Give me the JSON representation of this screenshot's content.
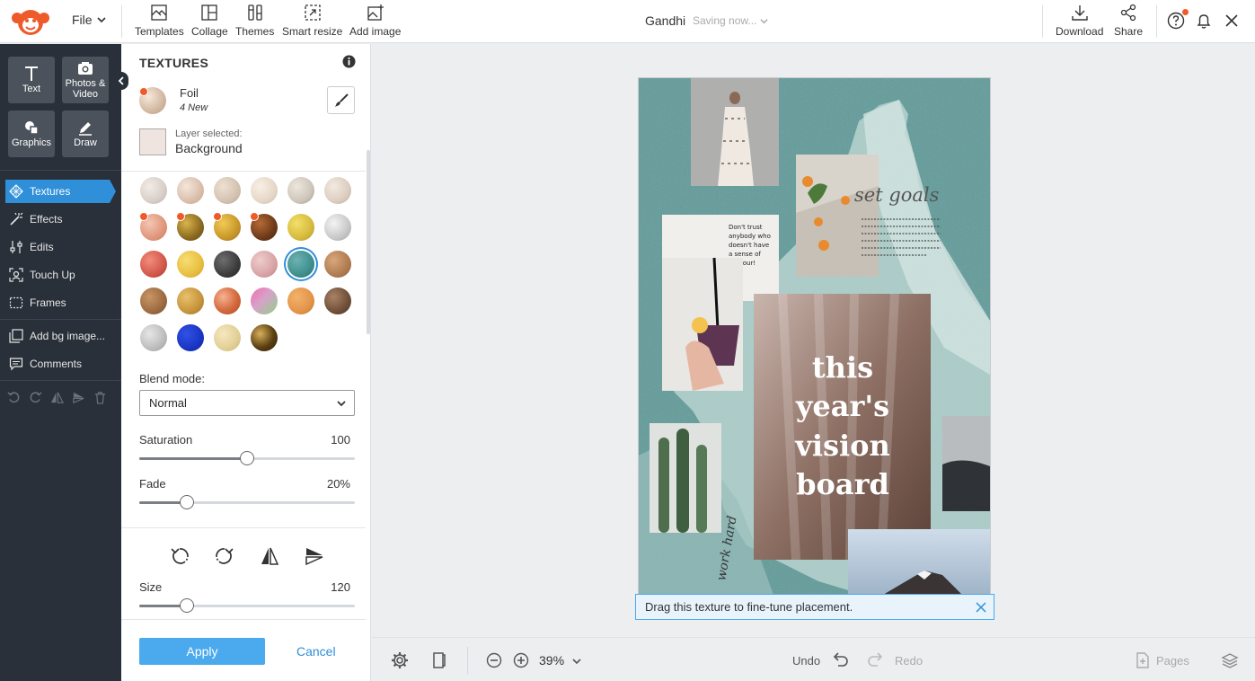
{
  "topbar": {
    "file_label": "File",
    "tools": [
      {
        "label": "Templates",
        "icon": "templates-icon"
      },
      {
        "label": "Collage",
        "icon": "collage-icon"
      },
      {
        "label": "Themes",
        "icon": "themes-icon"
      },
      {
        "label": "Smart resize",
        "icon": "smart-resize-icon"
      },
      {
        "label": "Add image",
        "icon": "add-image-icon"
      }
    ],
    "doc_title": "Gandhi",
    "saving_status": "Saving now...",
    "download_label": "Download",
    "share_label": "Share",
    "accent": "#ee5a2a"
  },
  "leftnav": {
    "big_buttons": [
      {
        "label": "Text",
        "icon": "text-icon"
      },
      {
        "label": "Photos & Video",
        "icon": "camera-icon"
      },
      {
        "label": "Graphics",
        "icon": "graphics-icon"
      },
      {
        "label": "Draw",
        "icon": "draw-icon"
      }
    ],
    "items": [
      {
        "label": "Textures",
        "icon": "textures-icon",
        "active": true
      },
      {
        "label": "Effects",
        "icon": "effects-icon"
      },
      {
        "label": "Edits",
        "icon": "edits-icon"
      },
      {
        "label": "Touch Up",
        "icon": "touch-up-icon"
      },
      {
        "label": "Frames",
        "icon": "frames-icon"
      },
      {
        "label": "Add bg image...",
        "icon": "add-bg-image-icon"
      },
      {
        "label": "Comments",
        "icon": "comments-icon"
      }
    ],
    "active_color": "#2f8fd8"
  },
  "panel": {
    "title": "TEXTURES",
    "category_name": "Foil",
    "category_sub": "4 New",
    "layer_label": "Layer selected:",
    "layer_value": "Background",
    "blend_label": "Blend mode:",
    "blend_value": "Normal",
    "saturation_label": "Saturation",
    "saturation_value": "100",
    "saturation_level": 0.5,
    "fade_label": "Fade",
    "fade_value": "20%",
    "fade_level": 0.22,
    "size_label": "Size",
    "size_value": "120",
    "size_level": 0.22,
    "apply_label": "Apply",
    "cancel_label": "Cancel",
    "swatches": [
      {
        "c": "radial-gradient(circle at 35% 35%, #f2ebe6, #d8cfc8 60%, #bdb2aa)"
      },
      {
        "c": "radial-gradient(circle at 35% 35%, #f5e6da, #d9bfab 60%, #c2a48d)"
      },
      {
        "c": "radial-gradient(circle at 35% 35%, #eee0d2, #d4c2b1 60%, #b9a897)"
      },
      {
        "c": "radial-gradient(circle at 35% 35%, #f8efe4, #e6d8c8 60%, #cbbba8)"
      },
      {
        "c": "radial-gradient(circle at 35% 35%, #ece6dd, #cfc6ba 60%, #a49b8f)"
      },
      {
        "c": "radial-gradient(circle at 35% 35%, #f3eae2, #dccdc0 60%, #c0ae9e)"
      },
      {
        "c": "radial-gradient(circle at 35% 35%, #f4c6b4, #e0967c 60%, #c97a62)",
        "new": true
      },
      {
        "c": "radial-gradient(circle at 35% 35%, #d9b44a, #8b6a20 60%, #5a4312)",
        "new": true
      },
      {
        "c": "radial-gradient(circle at 35% 35%, #f0cb53, #c9972b 60%, #9c6f17)",
        "new": true
      },
      {
        "c": "radial-gradient(circle at 35% 35%, #b56a35, #6d3a19 60%, #4a2410)",
        "new": true
      },
      {
        "c": "radial-gradient(circle at 35% 35%, #f3df6a, #d6bb3d 60%, #b3972a)"
      },
      {
        "c": "radial-gradient(circle at 35% 35%, #f4f4f4, #c8c8c8 60%, #a2a2a2)"
      },
      {
        "c": "radial-gradient(circle at 35% 35%, #f28d7d, #d2584a 60%, #a8392e)"
      },
      {
        "c": "radial-gradient(circle at 35% 35%, #f7dd74, #e8bf40 60%, #c99c22)"
      },
      {
        "c": "radial-gradient(circle at 35% 35%, #6e6e6e, #3c3c3c 60%, #222222)"
      },
      {
        "c": "radial-gradient(circle at 35% 35%, #f0cccc, #d7a4a6 60%, #b98587)"
      },
      {
        "c": "radial-gradient(circle at 35% 35%, #6fb2b2, #3f8f8f 60%, #2c7070)",
        "selected": true
      },
      {
        "c": "radial-gradient(circle at 35% 35%, #d8a77a, #b07c52 60%, #8d5f3c)"
      },
      {
        "c": "radial-gradient(circle at 35% 35%, #c99564, #9c6b42 60%, #7a4f2e)"
      },
      {
        "c": "radial-gradient(circle at 35% 35%, #e8c06a, #c6943c 60%, #a07226)"
      },
      {
        "c": "radial-gradient(circle at 35% 35%, #f7b293, #d36a3e 55%, #b14a22)"
      },
      {
        "c": "linear-gradient(135deg, #f06fb0, #d7a2c8 45%, #8fd08a 100%)"
      },
      {
        "c": "radial-gradient(circle at 35% 35%, #f2b36a, #e3944a 60%, #c57831)"
      },
      {
        "c": "radial-gradient(circle at 35% 35%, #a88266, #6f4f38 60%, #4e3524)"
      },
      {
        "c": "radial-gradient(circle at 35% 35%, #e6e6e6, #bdbdbd 60%, #9c9c9c)"
      },
      {
        "c": "radial-gradient(circle at 35% 35%, #3152e6, #1a35c4 60%, #0f2394)"
      },
      {
        "c": "radial-gradient(circle at 35% 35%, #f6e7bf, #e2cf96 60%, #c9b473)"
      },
      {
        "c": "radial-gradient(circle at 35% 35%, #d8b05a, #5b4012 55%, #2e2008)"
      }
    ]
  },
  "canvas": {
    "headline": [
      "this",
      "year's",
      "vision",
      "board"
    ],
    "goals_script": "set goals",
    "note_text": "Don't trust anybody who doesn't have a sense of humour!",
    "vertical_script": "work hard",
    "tooltip": "Drag this texture to fine-tune placement."
  },
  "bottombar": {
    "zoom": "39%",
    "undo_label": "Undo",
    "redo_label": "Redo",
    "pages_label": "Pages"
  }
}
